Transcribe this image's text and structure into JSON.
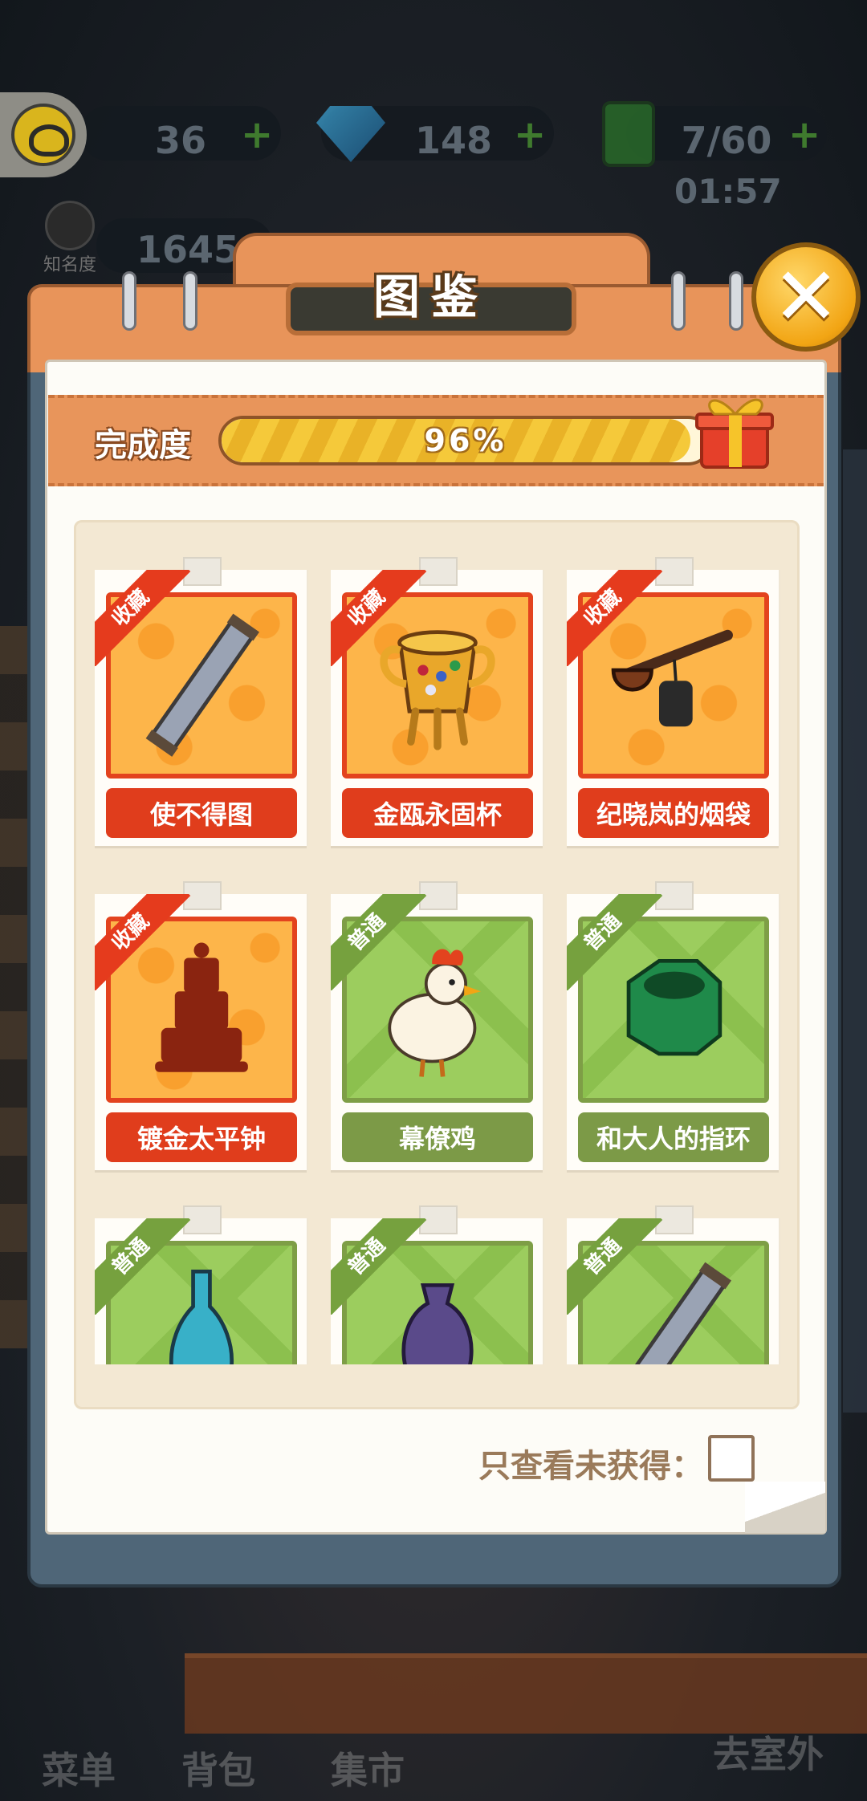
{
  "topbar": {
    "coins": "36",
    "gems": "148",
    "energy": "7/60",
    "energy_timer": "01:57",
    "fame_value": "1645",
    "fame_label": "知名度",
    "plus": "+"
  },
  "bottom_nav": {
    "menu": "菜单",
    "bag": "背包",
    "market": "集市",
    "outdoor": "去室外"
  },
  "dialog": {
    "title": "图鉴",
    "close": "✕",
    "progress_label": "完成度",
    "progress_text": "96%",
    "progress_value": 0.96,
    "filter_label": "只查看未获得："
  },
  "colors": {
    "rare": "#e03d1c",
    "common": "#7c9a47",
    "header": "#e8945a"
  },
  "items": [
    {
      "tag": "收藏",
      "name": "使不得图",
      "rarity": "rare",
      "icon": "scroll-icon"
    },
    {
      "tag": "收藏",
      "name": "金瓯永固杯",
      "rarity": "rare",
      "icon": "golden-cup-icon"
    },
    {
      "tag": "收藏",
      "name": "纪晓岚的烟袋",
      "rarity": "rare",
      "icon": "pipe-icon"
    },
    {
      "tag": "收藏",
      "name": "镀金太平钟",
      "rarity": "rare",
      "icon": "clock-silhouette-icon"
    },
    {
      "tag": "普通",
      "name": "幕僚鸡",
      "rarity": "common",
      "icon": "chicken-icon"
    },
    {
      "tag": "普通",
      "name": "和大人的指环",
      "rarity": "common",
      "icon": "jade-ring-icon"
    },
    {
      "tag": "普通",
      "name": "",
      "rarity": "common",
      "icon": "blue-vase-icon"
    },
    {
      "tag": "普通",
      "name": "",
      "rarity": "common",
      "icon": "purple-vase-icon"
    },
    {
      "tag": "普通",
      "name": "",
      "rarity": "common",
      "icon": "scroll-icon"
    }
  ]
}
